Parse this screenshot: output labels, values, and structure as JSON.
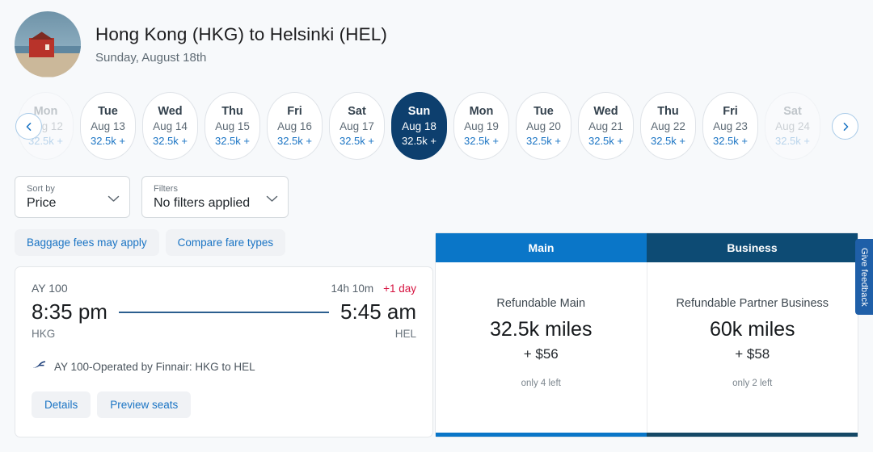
{
  "header": {
    "title": "Hong Kong (HKG) to Helsinki (HEL)",
    "subtitle": "Sunday, August 18th",
    "avatar_icon": "cabin-photo-avatar"
  },
  "carousel": {
    "prev_icon": "chevron-left-icon",
    "next_icon": "chevron-right-icon",
    "dates": [
      {
        "dow": "Mon",
        "date": "Aug 12",
        "price": "32.5k +",
        "selected": false,
        "faded": true
      },
      {
        "dow": "Tue",
        "date": "Aug 13",
        "price": "32.5k +",
        "selected": false,
        "faded": false
      },
      {
        "dow": "Wed",
        "date": "Aug 14",
        "price": "32.5k +",
        "selected": false,
        "faded": false
      },
      {
        "dow": "Thu",
        "date": "Aug 15",
        "price": "32.5k +",
        "selected": false,
        "faded": false
      },
      {
        "dow": "Fri",
        "date": "Aug 16",
        "price": "32.5k +",
        "selected": false,
        "faded": false
      },
      {
        "dow": "Sat",
        "date": "Aug 17",
        "price": "32.5k +",
        "selected": false,
        "faded": false
      },
      {
        "dow": "Sun",
        "date": "Aug 18",
        "price": "32.5k +",
        "selected": true,
        "faded": false
      },
      {
        "dow": "Mon",
        "date": "Aug 19",
        "price": "32.5k +",
        "selected": false,
        "faded": false
      },
      {
        "dow": "Tue",
        "date": "Aug 20",
        "price": "32.5k +",
        "selected": false,
        "faded": false
      },
      {
        "dow": "Wed",
        "date": "Aug 21",
        "price": "32.5k +",
        "selected": false,
        "faded": false
      },
      {
        "dow": "Thu",
        "date": "Aug 22",
        "price": "32.5k +",
        "selected": false,
        "faded": false
      },
      {
        "dow": "Fri",
        "date": "Aug 23",
        "price": "32.5k +",
        "selected": false,
        "faded": false
      },
      {
        "dow": "Sat",
        "date": "Aug 24",
        "price": "32.5k +",
        "selected": false,
        "faded": true
      }
    ]
  },
  "controls": {
    "sort": {
      "label": "Sort by",
      "value": "Price",
      "icon": "chevron-down-icon"
    },
    "filters": {
      "label": "Filters",
      "value": "No filters applied",
      "icon": "chevron-down-icon"
    },
    "baggage_link": "Baggage fees may apply",
    "compare_link": "Compare fare types"
  },
  "flight": {
    "number": "AY 100",
    "duration": "14h 10m",
    "day_offset": "+1 day",
    "depart_time": "8:35 pm",
    "arrive_time": "5:45 am",
    "depart_code": "HKG",
    "arrive_code": "HEL",
    "operated_by": "AY 100-Operated by Finnair: HKG to HEL",
    "airline_icon": "finnair-logo-icon",
    "details_button": "Details",
    "preview_button": "Preview seats"
  },
  "fares": {
    "tabs": [
      {
        "label": "Main",
        "active": true
      },
      {
        "label": "Business",
        "active": false
      }
    ],
    "options": [
      {
        "name": "Refundable Main",
        "miles": "32.5k miles",
        "cash": "+ $56",
        "seats_left": "only 4 left"
      },
      {
        "name": "Refundable Partner Business",
        "miles": "60k miles",
        "cash": "+ $58",
        "seats_left": "only 2 left"
      }
    ]
  },
  "feedback": {
    "label": "Give feedback"
  },
  "colors": {
    "accent_blue": "#0a76c8",
    "navy": "#0d4b74",
    "selected_pill": "#0d3f6e",
    "link_blue": "#1a74c4",
    "alert_red": "#d6123f",
    "page_bg": "#f7f9fb"
  }
}
